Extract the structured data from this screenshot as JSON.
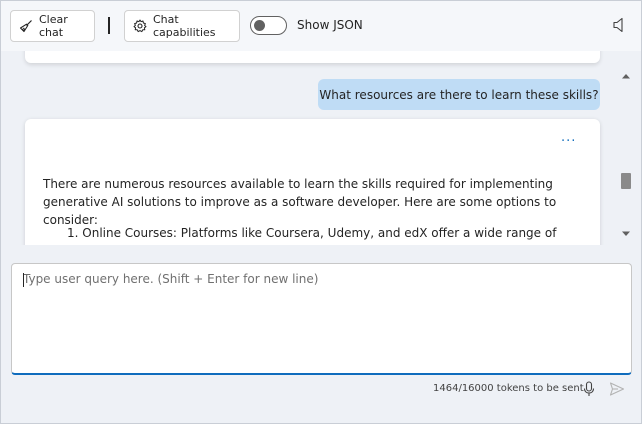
{
  "toolbar": {
    "clear_chat_label": "Clear chat",
    "chat_capabilities_label": "Chat capabilities",
    "show_json_label": "Show JSON",
    "show_json_on": false
  },
  "chat": {
    "user_message": "What resources are there to learn these skills?",
    "more_label": "···",
    "assistant_intro": "There are numerous resources available to learn the skills required for implementing generative AI solutions to improve as a software developer. Here are some options to consider:",
    "assistant_list": [
      "Online Courses: Platforms like Coursera, Udemy, and edX offer a wide range of courses on"
    ]
  },
  "input": {
    "placeholder": "Type user query here. (Shift + Enter for new line)",
    "value": ""
  },
  "footer": {
    "token_status": "1464/16000 tokens to be sent"
  },
  "colors": {
    "accent": "#0f6cbd",
    "user_bubble": "#bfdcf5",
    "background": "#eef1f6"
  }
}
